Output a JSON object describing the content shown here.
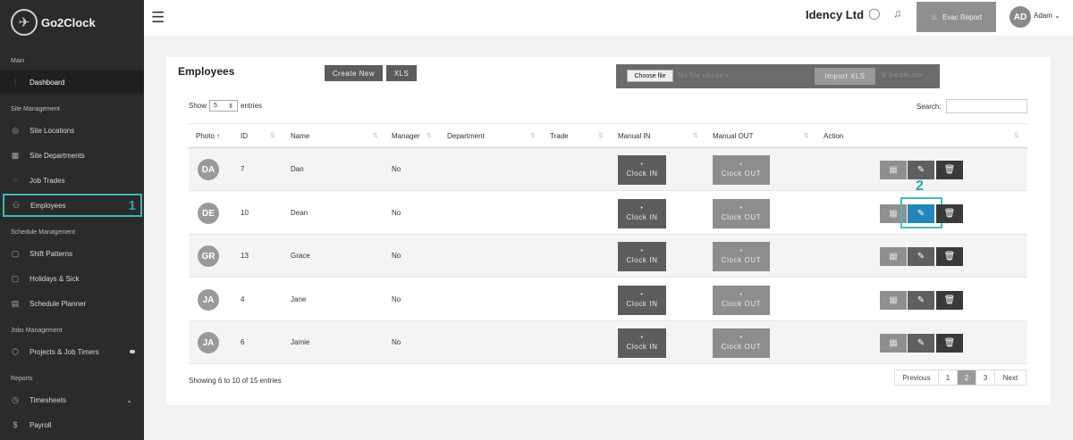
{
  "brand": {
    "name": "Go2Clock",
    "logo_icon": "clock-icon"
  },
  "sidebar": {
    "sections": [
      {
        "label": "Main"
      },
      {
        "label": "Site Management"
      },
      {
        "label": "Schedule Management"
      },
      {
        "label": "Jobs Management"
      },
      {
        "label": "Reports"
      }
    ],
    "items": [
      {
        "label": "Dashboard",
        "icon": "sliders-icon"
      },
      {
        "label": "Site Locations",
        "icon": "globe-icon"
      },
      {
        "label": "Site Departments",
        "icon": "grid-icon"
      },
      {
        "label": "Job Trades",
        "icon": "shield-icon"
      },
      {
        "label": "Employees",
        "icon": "users-icon"
      },
      {
        "label": "Shift Patterns",
        "icon": "clipboard-icon"
      },
      {
        "label": "Holidays & Sick",
        "icon": "clipboard-icon"
      },
      {
        "label": "Schedule Planner",
        "icon": "calendar-icon"
      },
      {
        "label": "Projects & Job Timers",
        "icon": "box-icon"
      },
      {
        "label": "Timesheets",
        "icon": "clock-icon"
      },
      {
        "label": "Payroll",
        "icon": "dollar-icon"
      }
    ],
    "callout": "1"
  },
  "topbar": {
    "company": "Idency Ltd",
    "evac_label": "Evac Report",
    "user_initials": "AD",
    "user_name": "Adam"
  },
  "page": {
    "title": "Employees",
    "create_label": "Create New",
    "xls_label": "XLS",
    "choose_file_label": "Choose file",
    "no_file_text": "No file chosen",
    "import_label": "Import XLS",
    "sample_label": "Sample.xlsx",
    "show_label": "Show",
    "show_value": "5",
    "entries_label": "entries",
    "search_label": "Search:",
    "callout": "2"
  },
  "table": {
    "columns": [
      "Photo",
      "ID",
      "Name",
      "Manager",
      "Department",
      "Trade",
      "Manual IN",
      "Manual OUT",
      "Action"
    ],
    "clock_in_label": "Clock IN",
    "clock_out_label": "Clock OUT",
    "rows": [
      {
        "initials": "DA",
        "id": "7",
        "name": "Dan",
        "manager": "No"
      },
      {
        "initials": "DE",
        "id": "10",
        "name": "Dean",
        "manager": "No"
      },
      {
        "initials": "GR",
        "id": "13",
        "name": "Grace",
        "manager": "No"
      },
      {
        "initials": "JA",
        "id": "4",
        "name": "Jane",
        "manager": "No"
      },
      {
        "initials": "JA",
        "id": "6",
        "name": "Jamie",
        "manager": "No"
      }
    ],
    "highlighted_edit_row": 1
  },
  "footer": {
    "info": "Showing 6 to 10 of 15 entries",
    "pages": [
      "Previous",
      "1",
      "2",
      "3",
      "Next"
    ],
    "current_page": "2"
  }
}
